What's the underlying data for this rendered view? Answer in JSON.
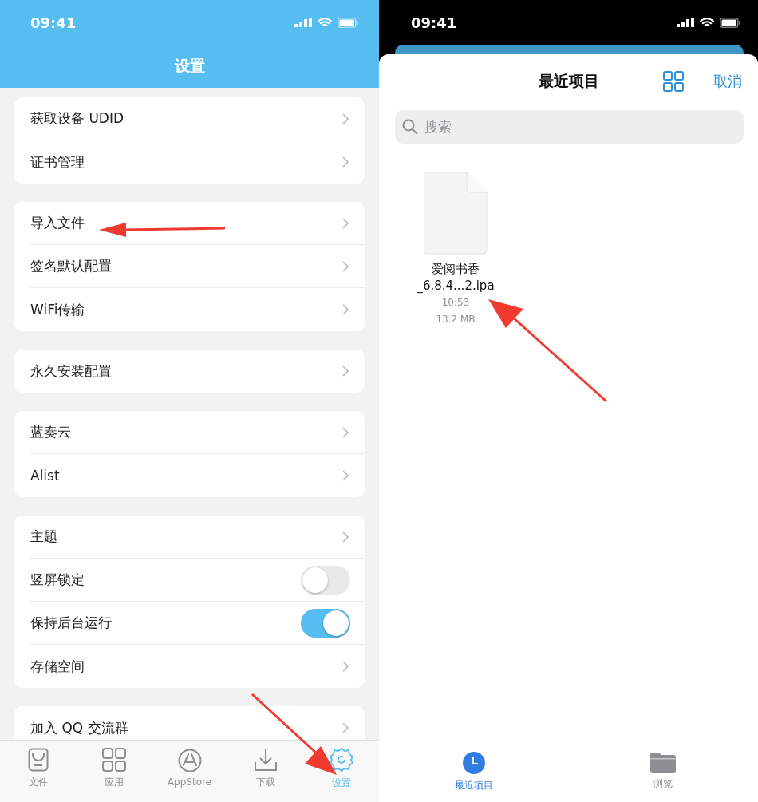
{
  "left_screen": {
    "status_bar": {
      "time": "09:41"
    },
    "title": "设置",
    "groups": [
      [
        {
          "kind": "link",
          "label": "获取设备 UDID"
        },
        {
          "kind": "link",
          "label": "证书管理"
        }
      ],
      [
        {
          "kind": "link",
          "label": "导入文件"
        },
        {
          "kind": "link",
          "label": "签名默认配置"
        },
        {
          "kind": "link",
          "label": "WiFi传输"
        }
      ],
      [
        {
          "kind": "link",
          "label": "永久安装配置"
        }
      ],
      [
        {
          "kind": "link",
          "label": "蓝奏云"
        },
        {
          "kind": "link",
          "label": "Alist"
        }
      ],
      [
        {
          "kind": "link",
          "label": "主题"
        },
        {
          "kind": "toggle",
          "label": "竖屏锁定",
          "on": false
        },
        {
          "kind": "toggle",
          "label": "保持后台运行",
          "on": true
        },
        {
          "kind": "link",
          "label": "存储空间"
        }
      ],
      [
        {
          "kind": "link",
          "label": "加入 QQ 交流群"
        }
      ]
    ],
    "tabs": [
      {
        "label": "文件",
        "selected": false
      },
      {
        "label": "应用",
        "selected": false
      },
      {
        "label": "AppStore",
        "selected": false
      },
      {
        "label": "下载",
        "selected": false
      },
      {
        "label": "设置",
        "selected": true
      }
    ]
  },
  "right_screen": {
    "status_bar": {
      "time": "09:41"
    },
    "title": "最近项目",
    "cancel": "取消",
    "search": {
      "placeholder": "搜索"
    },
    "files": [
      {
        "name_line_1": "爱阅书香",
        "name_line_2": "_6.8.4...2.ipa",
        "time": "10:53",
        "size": "13.2 MB"
      }
    ],
    "tabs": [
      {
        "label": "最近项目",
        "selected": true
      },
      {
        "label": "浏览",
        "selected": false
      }
    ]
  }
}
